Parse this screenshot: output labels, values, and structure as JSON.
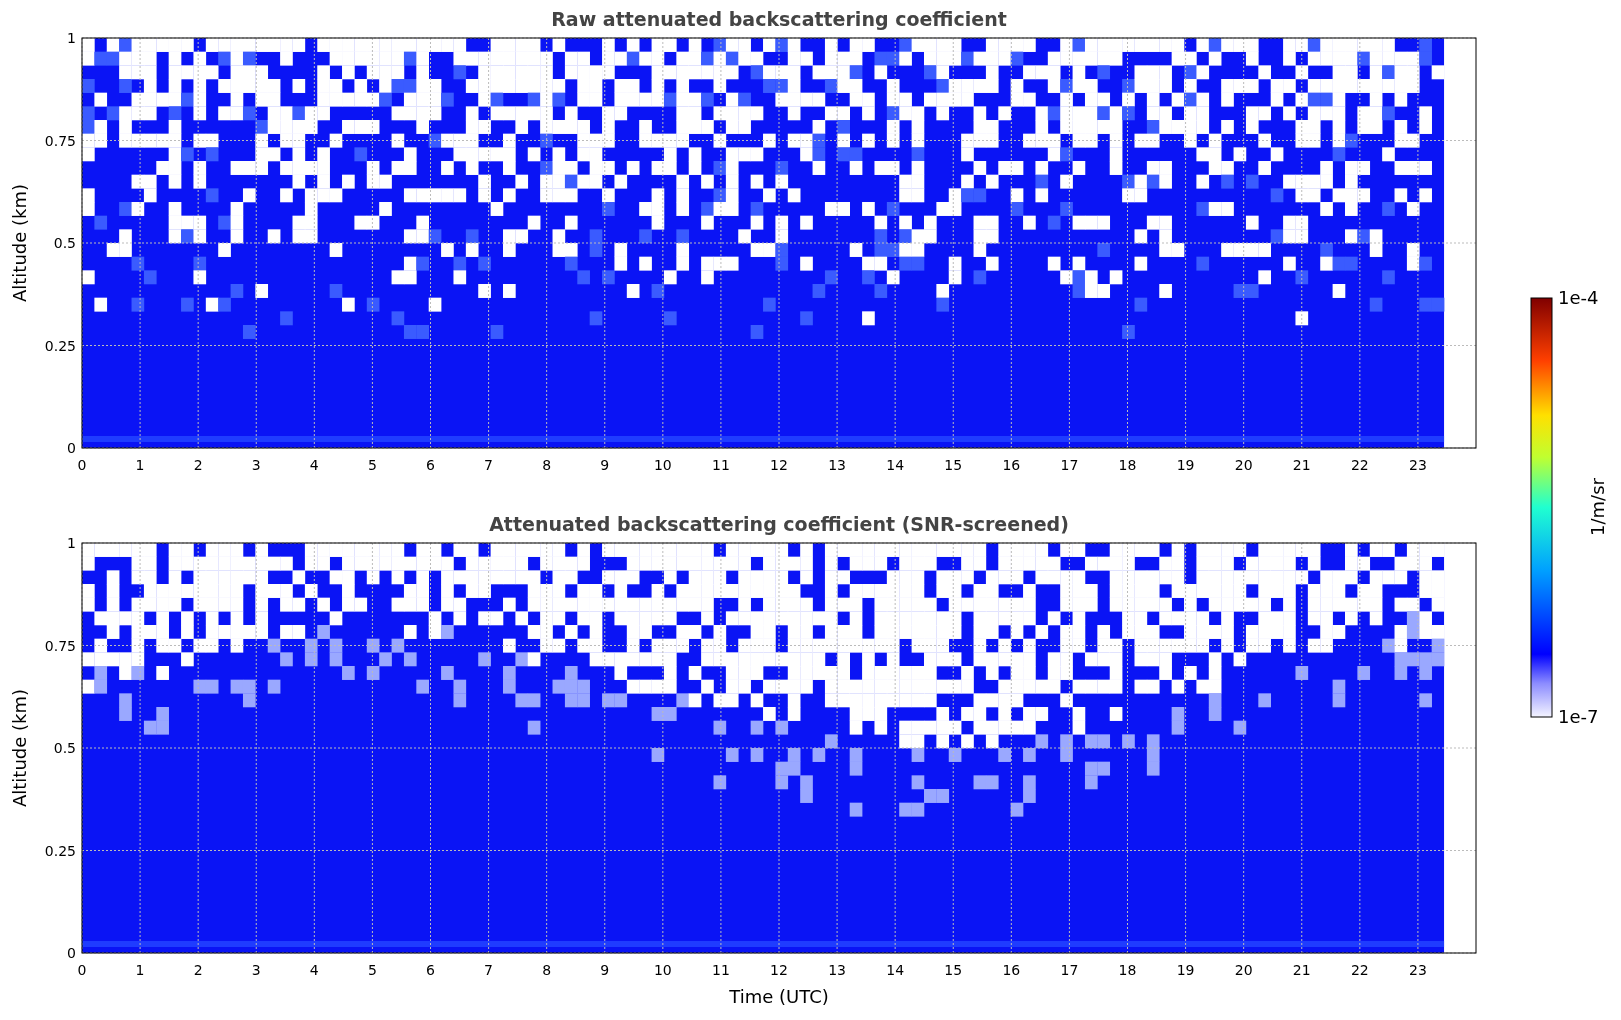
{
  "panels": [
    {
      "kind": "raw",
      "title": "Raw attenuated backscattering coefficient",
      "ylabel": "Altitude (km)",
      "yticks": [
        "1",
        "0.75",
        "0.5",
        "0.25",
        "0"
      ],
      "xticks": [
        "0",
        "1",
        "2",
        "3",
        "4",
        "5",
        "6",
        "7",
        "8",
        "9",
        "10",
        "11",
        "12",
        "13",
        "14",
        "15",
        "16",
        "17",
        "18",
        "19",
        "20",
        "21",
        "22",
        "23"
      ]
    },
    {
      "kind": "screened",
      "title": "Attenuated backscattering coefficient (SNR-screened)",
      "ylabel": "Altitude (km)",
      "xlabel": "Time (UTC)",
      "yticks": [
        "1",
        "0.75",
        "0.5",
        "0.25",
        "0"
      ],
      "xticks": [
        "0",
        "1",
        "2",
        "3",
        "4",
        "5",
        "6",
        "7",
        "8",
        "9",
        "10",
        "11",
        "12",
        "13",
        "14",
        "15",
        "16",
        "17",
        "18",
        "19",
        "20",
        "21",
        "22",
        "23"
      ]
    }
  ],
  "colorbar": {
    "label": "1/m/sr",
    "max_label": "1e-4",
    "min_label": "1e-7"
  }
}
